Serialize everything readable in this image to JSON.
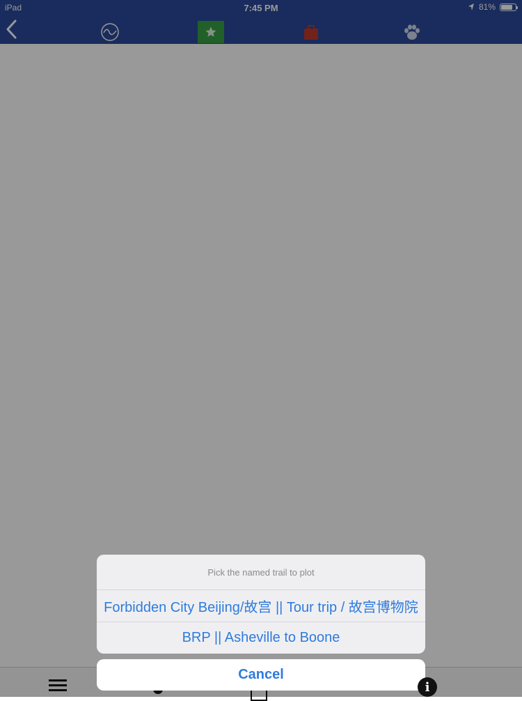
{
  "status_bar": {
    "device": "iPad",
    "time": "7:45 PM",
    "battery_text": "81%",
    "battery_level": 0.81
  },
  "toolbar": {
    "icons": [
      "back-chevron-icon",
      "wave-icon",
      "star-icon",
      "briefcase-icon",
      "paw-icon"
    ],
    "colors": {
      "background": "#2b4a9b",
      "star_tab": "#3aa047",
      "briefcase": "#c0392b"
    }
  },
  "tabbar": {
    "icons": [
      "menu-icon",
      "pin-icon",
      "square-icon",
      "info-icon"
    ],
    "info_glyph": "i"
  },
  "action_sheet": {
    "title": "Pick the named trail to plot",
    "options": [
      "Forbidden City Beijing/故宫 || Tour trip / 故宫博物院",
      "BRP || Asheville to Boone"
    ],
    "cancel_label": "Cancel",
    "accent_color": "#2f7bdc"
  }
}
